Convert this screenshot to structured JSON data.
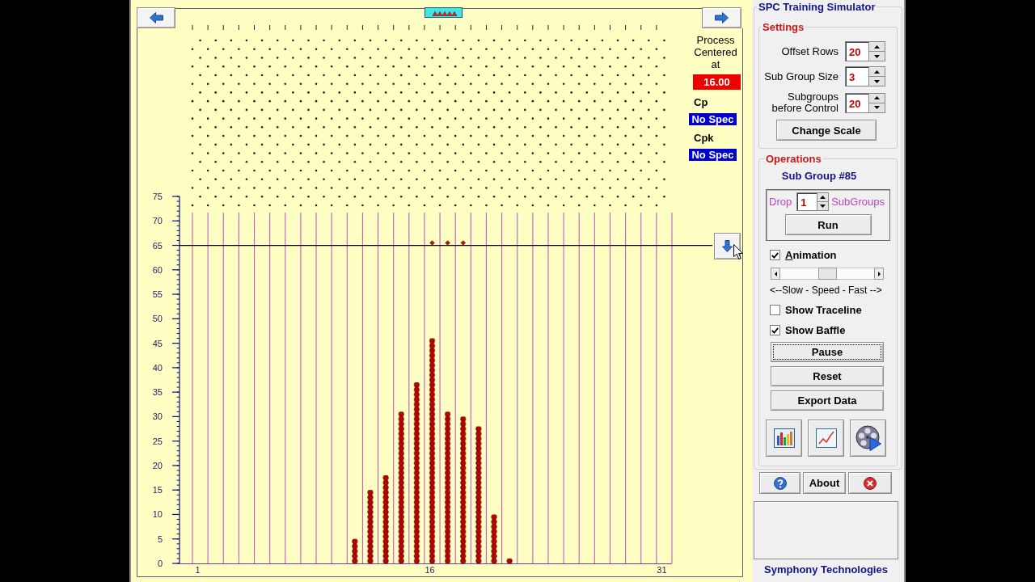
{
  "board": {
    "info": {
      "process_label": "Process Centered at",
      "process_center": "16.00",
      "cp_label": "Cp",
      "cp_value": "No Spec",
      "cpk_label": "Cpk",
      "cpk_value": "No Spec"
    },
    "chart_data": {
      "type": "bar",
      "categories": [
        "1",
        null,
        null,
        null,
        null,
        null,
        null,
        null,
        null,
        null,
        null,
        null,
        null,
        null,
        null,
        "16",
        null,
        null,
        null,
        null,
        null,
        null,
        null,
        null,
        null,
        null,
        null,
        null,
        null,
        null,
        "31"
      ],
      "series": [
        {
          "color": "#c00000",
          "values": [
            0,
            0,
            0,
            0,
            0,
            0,
            0,
            0,
            0,
            0,
            5,
            15,
            18,
            31,
            37,
            46,
            31,
            30,
            28,
            10,
            1,
            0,
            0,
            0,
            0,
            0,
            0,
            0,
            0,
            0,
            0
          ]
        },
        {
          "type": "scatter",
          "marker": "diamond",
          "color": "#a02010",
          "values": [
            null,
            null,
            null,
            null,
            null,
            null,
            null,
            null,
            null,
            null,
            null,
            null,
            null,
            null,
            null,
            65.5,
            65.5,
            65.5,
            null,
            null,
            null,
            null,
            null,
            null,
            null,
            null,
            null,
            null,
            null,
            null,
            null
          ]
        }
      ],
      "ylim": [
        0,
        75
      ],
      "yticks": [
        0,
        5,
        10,
        15,
        20,
        25,
        30,
        35,
        40,
        45,
        50,
        55,
        60,
        65,
        70,
        75
      ],
      "ref_lines": [
        {
          "axis": "y",
          "value": 65,
          "color": "#000000"
        }
      ]
    }
  },
  "panel": {
    "title": "SPC Training Simulator",
    "settings": {
      "title": "Settings",
      "fields": [
        {
          "label": "Offset Rows",
          "value": "20"
        },
        {
          "label": "Sub Group Size",
          "value": "3"
        },
        {
          "label": "Subgroups before Control",
          "value": "20"
        }
      ],
      "button": "Change Scale"
    },
    "operations": {
      "title": "Operations",
      "subgroup": "Sub Group #85",
      "drop_label": "Drop",
      "drop_value": "1",
      "drop_unit": "SubGroups",
      "run_button": "Run",
      "options": [
        {
          "kind": "checkbox",
          "label": "Animation",
          "checked": true,
          "mnemonic": true
        },
        {
          "kind": "slider",
          "level": 0.5,
          "caption": "<--Slow - Speed - Fast -->"
        },
        {
          "kind": "checkbox",
          "label": "Show Traceline",
          "checked": false,
          "mnemonic": false
        },
        {
          "kind": "checkbox",
          "label": "Show Baffle",
          "checked": true,
          "mnemonic": false
        }
      ],
      "buttons": [
        {
          "label": "Pause",
          "focused": true
        },
        {
          "label": "Reset",
          "focused": false
        },
        {
          "label": "Export Data",
          "focused": false
        }
      ]
    },
    "about_button": "About",
    "footer": "Symphony Technologies"
  }
}
